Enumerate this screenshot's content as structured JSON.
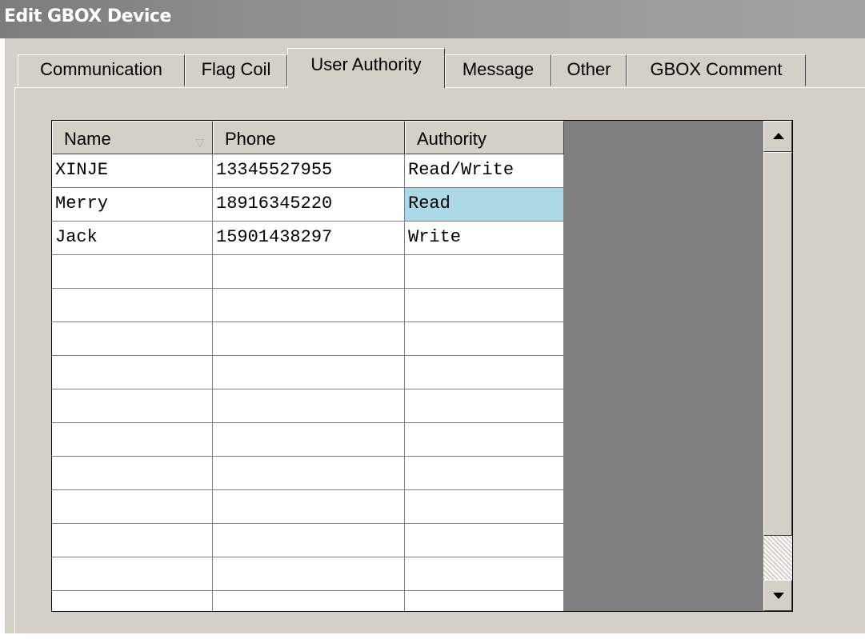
{
  "window": {
    "title": "Edit GBOX Device"
  },
  "tabs": [
    {
      "label": "Communication",
      "active": false
    },
    {
      "label": "Flag Coil",
      "active": false
    },
    {
      "label": "User Authority",
      "active": true
    },
    {
      "label": "Message",
      "active": false
    },
    {
      "label": "Other",
      "active": false
    },
    {
      "label": "GBOX Comment",
      "active": false
    }
  ],
  "grid": {
    "columns": [
      "Name",
      "Phone",
      "Authority"
    ],
    "sort_icon": "sort-down-icon",
    "rows": [
      {
        "name": "XINJE",
        "phone": "13345527955",
        "authority": "Read/Write"
      },
      {
        "name": "Merry",
        "phone": "18916345220",
        "authority": "Read"
      },
      {
        "name": "Jack",
        "phone": "15901438297",
        "authority": "Write"
      }
    ],
    "empty_rows": 11,
    "selected_cell": {
      "row": 1,
      "column": "authority"
    }
  },
  "colors": {
    "selection": "#add8e6",
    "dialog_bg": "#d4d0c8",
    "grid_empty_area": "#808080"
  }
}
